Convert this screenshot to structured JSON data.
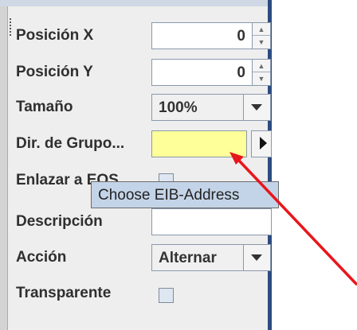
{
  "properties": {
    "pos_x": {
      "label": "Posición X",
      "value": "0"
    },
    "pos_y": {
      "label": "Posición Y",
      "value": "0"
    },
    "size": {
      "label": "Tamaño",
      "value": "100%"
    },
    "group_address": {
      "label": "Dir. de Grupo...",
      "value": ""
    },
    "link_to": {
      "label": "Enlazar a EOS",
      "checked": false
    },
    "description": {
      "label": "Descripción",
      "value": ""
    },
    "action": {
      "label": "Acción",
      "value": "Alternar"
    },
    "transparent": {
      "label": "Transparente",
      "checked": false
    }
  },
  "tooltip": {
    "text": "Choose EIB-Address"
  },
  "colors": {
    "highlight_field": "#ffff99",
    "tooltip_bg": "#c4d4e8",
    "annotation_arrow": "#e8161b",
    "panel_border": "#2b4c80"
  },
  "icons": {
    "spinner_up": "spin-up-icon",
    "spinner_down": "spin-down-icon",
    "dropdown": "chevron-down-icon",
    "picker": "arrow-right-icon"
  }
}
